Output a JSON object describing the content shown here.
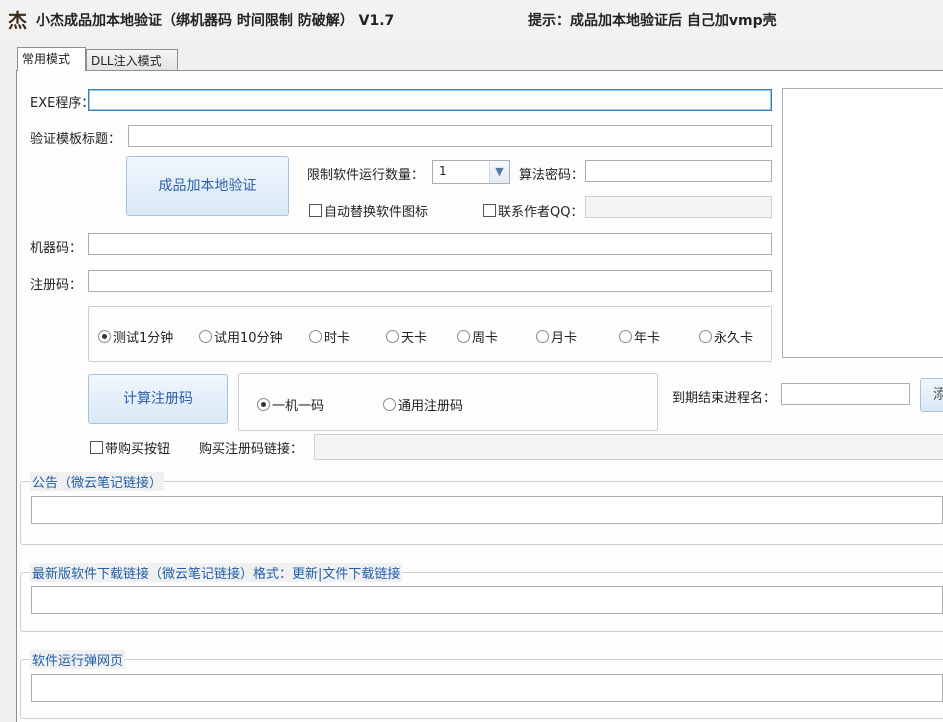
{
  "window": {
    "app_icon_glyph": "杰",
    "title": "小杰成品加本地验证（绑机器码 时间限制 防破解） V1.7",
    "hint": "提示：成品加本地验证后 自己加vmp壳"
  },
  "tabs": [
    "常用模式",
    "DLL注入模式"
  ],
  "form": {
    "exe_label": "EXE程序：",
    "exe_value": "",
    "template_title_label": "验证模板标题：",
    "template_title_value": "",
    "verify_button": "成品加本地验证",
    "run_limit_label": "限制软件运行数量：",
    "run_limit_value": "1",
    "algo_pwd_label": "算法密码：",
    "algo_pwd_value": "",
    "auto_icon_label": "自动替换软件图标",
    "contact_qq_label": "联系作者QQ：",
    "contact_qq_value": "",
    "machine_code_label": "机器码：",
    "machine_code_value": "",
    "reg_code_label": "注册码：",
    "reg_code_value": ""
  },
  "durations": {
    "options": [
      "测试1分钟",
      "试用10分钟",
      "时卡",
      "天卡",
      "周卡",
      "月卡",
      "年卡",
      "永久卡"
    ],
    "selected_index": 0
  },
  "calc": {
    "button": "计算注册码",
    "modes": [
      "一机一码",
      "通用注册码"
    ],
    "selected_index": 0
  },
  "expire": {
    "label": "到期结束进程名：",
    "value": "",
    "add_button": "添"
  },
  "purchase": {
    "checkbox_label": "带购买按钮",
    "link_label": "购买注册码链接：",
    "link_value": ""
  },
  "groups": {
    "notice": "公告（微云笔记链接）",
    "download": "最新版软件下载链接（微云笔记链接）格式：更新|文件下载链接",
    "popup": "软件运行弹网页"
  },
  "colors": {
    "group_title": "#1f5ea8",
    "button_text": "#2c5fa8"
  }
}
